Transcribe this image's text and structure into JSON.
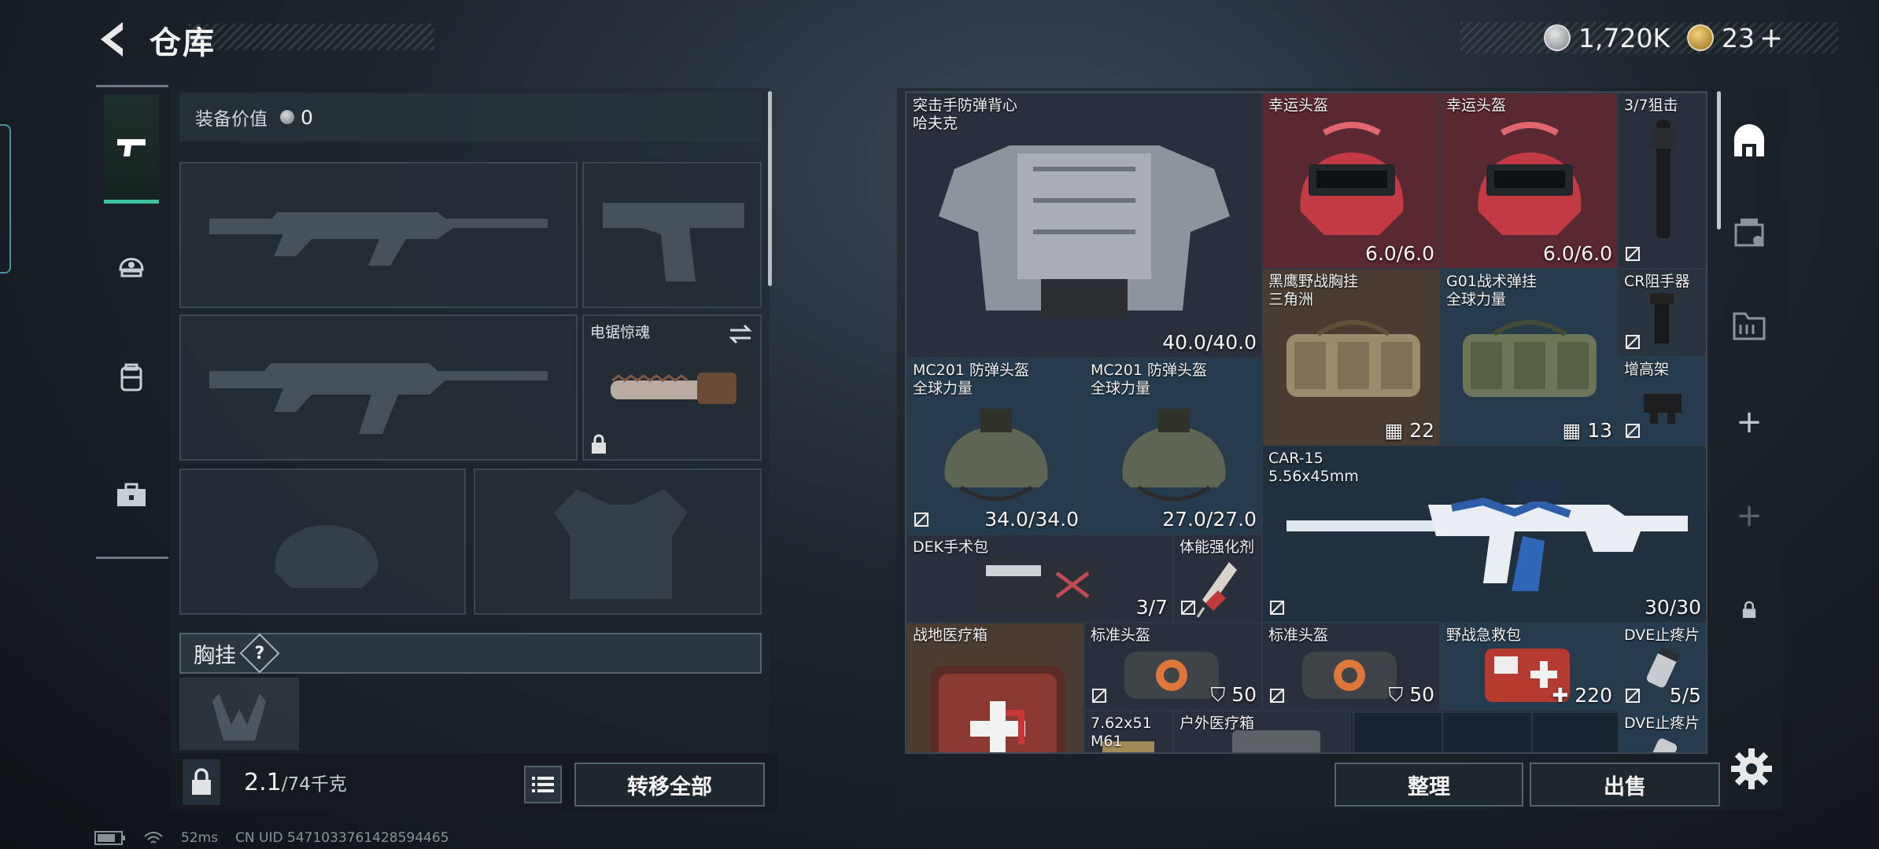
{
  "header": {
    "title": "仓库"
  },
  "currency": [
    {
      "type": "silver",
      "amount": "1,720K"
    },
    {
      "type": "gold",
      "amount": "23",
      "suffix": "+"
    }
  ],
  "loadout": {
    "value_label": "装备价值",
    "value": "0",
    "melee_label": "电锯惊魂",
    "chest_label": "胸挂",
    "chest_help": "?"
  },
  "footer_left": {
    "weight_current": "2.1",
    "weight_max": "/74千克",
    "transfer_all": "转移全部"
  },
  "status": {
    "ping": "52ms",
    "uid": "CN UID 5471033761428594465"
  },
  "storage_items": [
    {
      "id": "vest",
      "name": "突击手防弹背心\n哈夫克",
      "value": "40.0/40.0",
      "bg": "#2a2f3d"
    },
    {
      "id": "lucky-helmet-1",
      "name": "幸运头盔",
      "value": "6.0/6.0",
      "bg": "#5a2831"
    },
    {
      "id": "lucky-helmet-2",
      "name": "幸运头盔",
      "value": "6.0/6.0",
      "bg": "#5a2831"
    },
    {
      "id": "scope",
      "name": "3/7狙击",
      "value": ""
    },
    {
      "id": "blackhawk-rig",
      "name": "黑鹰野战胸挂\n三角洲",
      "value": "22"
    },
    {
      "id": "g01-rig",
      "name": "G01战术弹挂\n全球力量",
      "value": "13"
    },
    {
      "id": "cr-resistor",
      "name": "CR阻手器",
      "value": ""
    },
    {
      "id": "riser",
      "name": "增高架",
      "value": ""
    },
    {
      "id": "mc201-1",
      "name": "MC201 防弹头盔\n全球力量",
      "value": "34.0/34.0"
    },
    {
      "id": "mc201-2",
      "name": "MC201 防弹头盔\n全球力量",
      "value": "27.0/27.0"
    },
    {
      "id": "car15",
      "name": "CAR-15\n5.56x45mm",
      "value": "30/30"
    },
    {
      "id": "dek-kit",
      "name": "DEK手术包",
      "value": "3/7"
    },
    {
      "id": "stim",
      "name": "体能强化剂",
      "value": ""
    },
    {
      "id": "field-med-box",
      "name": "战地医疗箱",
      "value": ""
    },
    {
      "id": "std-helmet-1",
      "name": "标准头盔",
      "value": "50"
    },
    {
      "id": "std-helmet-2",
      "name": "标准头盔",
      "value": "50"
    },
    {
      "id": "first-aid",
      "name": "野战急救包",
      "value": "220"
    },
    {
      "id": "dve-1",
      "name": "DVE止疼片",
      "value": "5/5"
    },
    {
      "id": "ammo-762",
      "name": "7.62x51\nM61",
      "value": ""
    },
    {
      "id": "outdoor-med",
      "name": "户外医疗箱",
      "value": ""
    },
    {
      "id": "dve-2",
      "name": "DVE止疼片",
      "value": ""
    }
  ],
  "storage_footer": {
    "sort": "整理",
    "sell": "出售"
  },
  "icons": [
    "back-arrow-icon",
    "pistol-icon",
    "helmet-icon",
    "backpack-icon",
    "toolbox-icon",
    "lock-icon",
    "list-icon",
    "swap-icon",
    "safe-icon",
    "tab-icon",
    "plus-icon",
    "gear-icon",
    "silver-coin-icon",
    "gold-coin-icon"
  ]
}
